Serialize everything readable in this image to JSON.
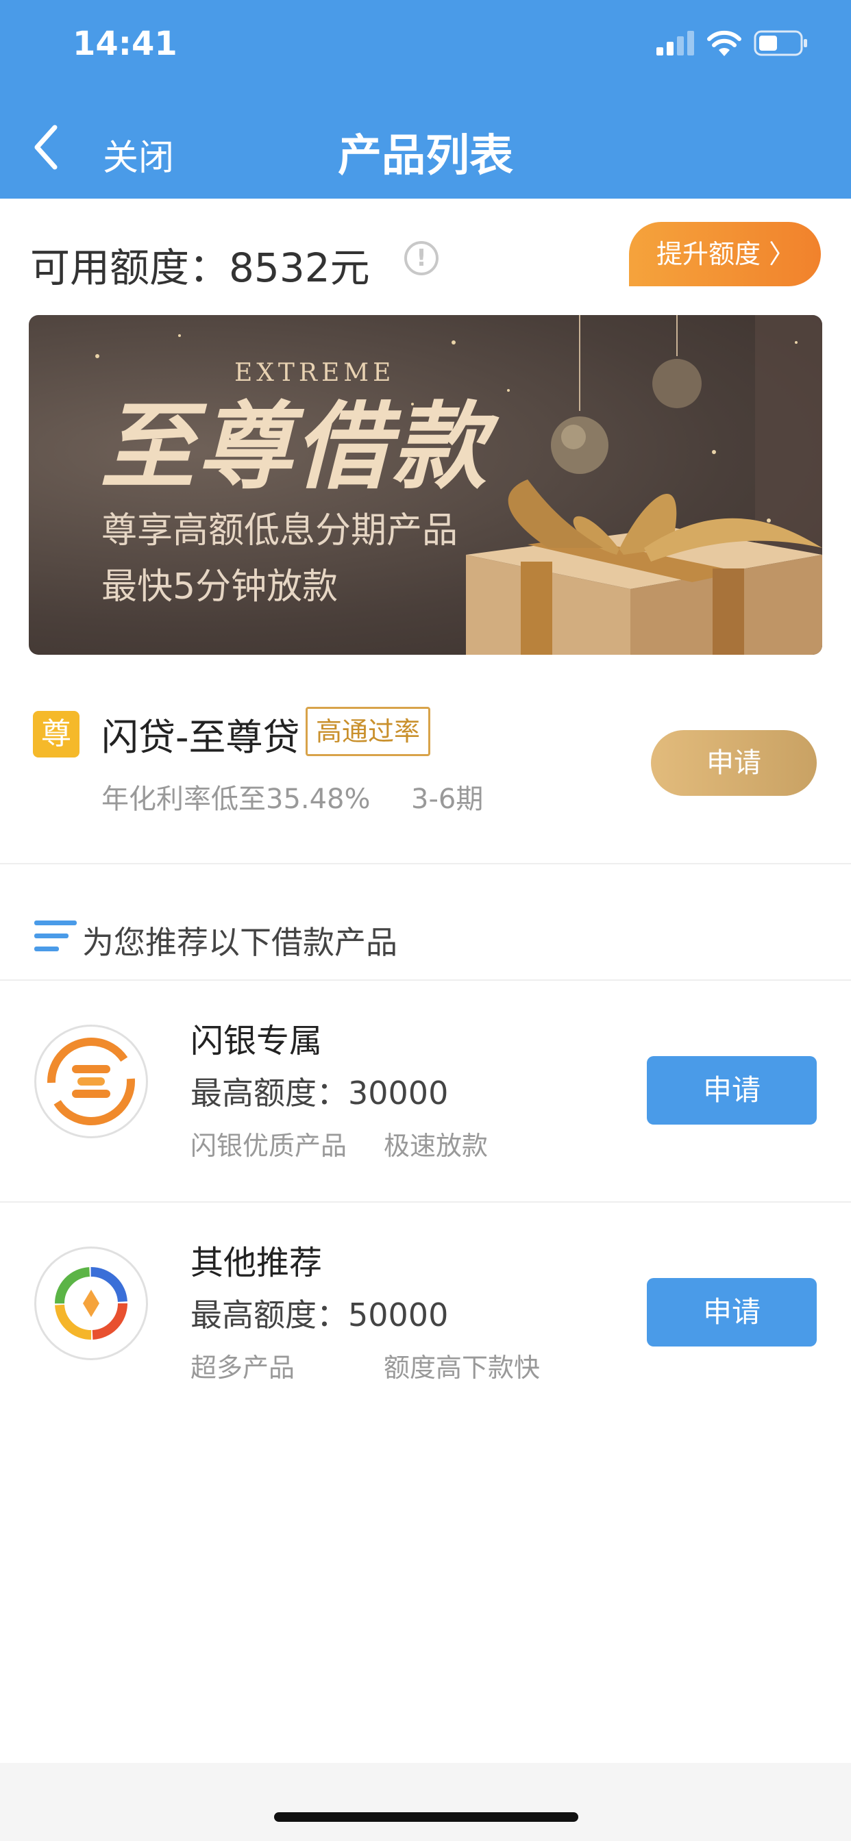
{
  "status_bar": {
    "time": "14:41"
  },
  "nav": {
    "close_label": "关闭",
    "title": "产品列表"
  },
  "credit": {
    "label": "可用额度：",
    "amount": "8532元",
    "raise_label": "提升额度 〉"
  },
  "banner": {
    "english_word": "EXTREME",
    "title": "至尊借款",
    "line1": "尊享高额低息分期产品",
    "line2": "最快5分钟放款"
  },
  "vip_product": {
    "badge": "尊",
    "name": "闪贷-至尊贷",
    "tag": "高通过率",
    "rate": "年化利率低至35.48%",
    "term": "3-6期",
    "apply_label": "申请"
  },
  "recommend": {
    "label": "为您推荐以下借款产品"
  },
  "products": [
    {
      "name": "闪银专属",
      "limit": "最高额度：30000",
      "feature1": "闪银优质产品",
      "feature2": "极速放款",
      "apply_label": "申请",
      "logo_icon": "shanyin-logo-icon"
    },
    {
      "name": "其他推荐",
      "limit": "最高额度：50000",
      "feature1": "超多产品",
      "feature2": "额度高下款快",
      "apply_label": "申请",
      "logo_icon": "colorful-ring-logo-icon"
    }
  ],
  "colors": {
    "header": "#4a9be8",
    "raise_button": "#f1822c",
    "vip_button": "#c9a264",
    "apply_button": "#4a9be8"
  }
}
